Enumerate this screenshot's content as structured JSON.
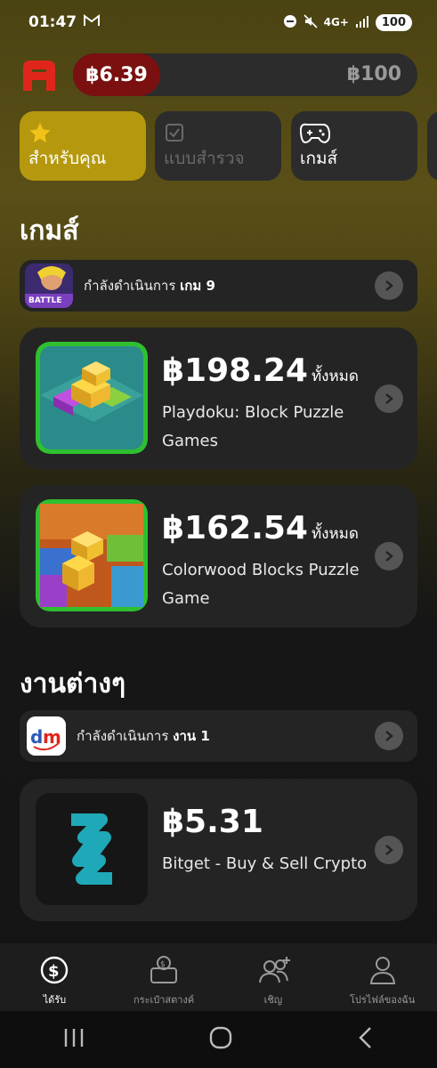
{
  "status": {
    "time": "01:47",
    "network": "4G+",
    "battery": "100"
  },
  "wallet": {
    "current": "฿6.39",
    "target": "฿100",
    "progress_fraction": 0.064
  },
  "tabs": [
    {
      "label": "สำหรับคุณ",
      "icon": "star-icon",
      "state": "active"
    },
    {
      "label": "แบบสำรวจ",
      "icon": "checkbox-icon",
      "state": "disabled"
    },
    {
      "label": "เกมส์",
      "icon": "gamepad-icon",
      "state": "normal"
    }
  ],
  "games": {
    "heading": "เกมส์",
    "in_progress": {
      "prefix": "กำลังดำเนินการ",
      "count": "เกม 9"
    },
    "cards": [
      {
        "amount": "฿198.24",
        "suffix": "ทั้งหมด",
        "title": "Playdoku: Block Puzzle Games"
      },
      {
        "amount": "฿162.54",
        "suffix": "ทั้งหมด",
        "title": "Colorwood Blocks Puzzle Game"
      }
    ]
  },
  "tasks": {
    "heading": "งานต่างๆ",
    "in_progress": {
      "prefix": "กำลังดำเนินการ",
      "count": "งาน 1"
    },
    "cards": [
      {
        "amount": "฿5.31",
        "title": "Bitget - Buy & Sell Crypto"
      }
    ]
  },
  "bottom_nav": [
    {
      "label": "ได้รับ",
      "icon": "dollar-coin-icon",
      "active": true
    },
    {
      "label": "กระเป๋าสตางค์",
      "icon": "wallet-icon",
      "active": false
    },
    {
      "label": "เชิญ",
      "icon": "invite-users-icon",
      "active": false
    },
    {
      "label": "โปรไฟล์ของฉัน",
      "icon": "profile-icon",
      "active": false
    }
  ],
  "colors": {
    "accent": "#b5980e",
    "balance_fill": "#7a1010",
    "logo_red": "#e0261b",
    "card_bg": "#242424"
  }
}
